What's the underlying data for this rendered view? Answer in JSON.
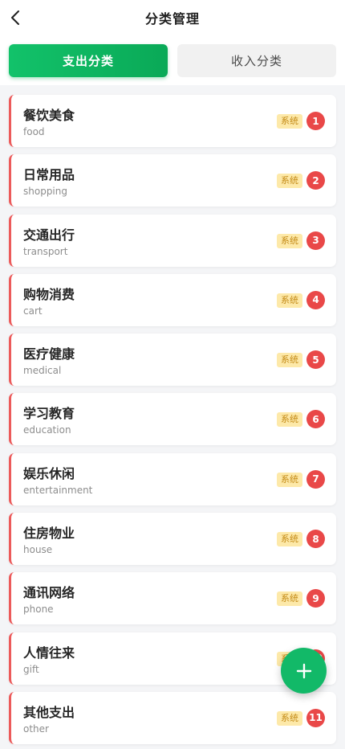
{
  "header": {
    "title": "分类管理",
    "back_icon": "chevron-left-icon"
  },
  "tabs": [
    {
      "label": "支出分类",
      "active": true
    },
    {
      "label": "收入分类",
      "active": false
    }
  ],
  "colors": {
    "accent": "#0aa957",
    "card_border": "#ec5a5a",
    "badge_bg": "#fde9a9",
    "badge_text": "#c48a16",
    "order_badge": "#e94848"
  },
  "categories": [
    {
      "name": "餐饮美食",
      "code": "food",
      "badge": "系统",
      "order": "1"
    },
    {
      "name": "日常用品",
      "code": "shopping",
      "badge": "系统",
      "order": "2"
    },
    {
      "name": "交通出行",
      "code": "transport",
      "badge": "系统",
      "order": "3"
    },
    {
      "name": "购物消费",
      "code": "cart",
      "badge": "系统",
      "order": "4"
    },
    {
      "name": "医疗健康",
      "code": "medical",
      "badge": "系统",
      "order": "5"
    },
    {
      "name": "学习教育",
      "code": "education",
      "badge": "系统",
      "order": "6"
    },
    {
      "name": "娱乐休闲",
      "code": "entertainment",
      "badge": "系统",
      "order": "7"
    },
    {
      "name": "住房物业",
      "code": "house",
      "badge": "系统",
      "order": "8"
    },
    {
      "name": "通讯网络",
      "code": "phone",
      "badge": "系统",
      "order": "9"
    },
    {
      "name": "人情往来",
      "code": "gift",
      "badge": "系统",
      "order": "10"
    },
    {
      "name": "其他支出",
      "code": "other",
      "badge": "系统",
      "order": "11"
    }
  ],
  "fab": {
    "icon": "plus-icon"
  }
}
